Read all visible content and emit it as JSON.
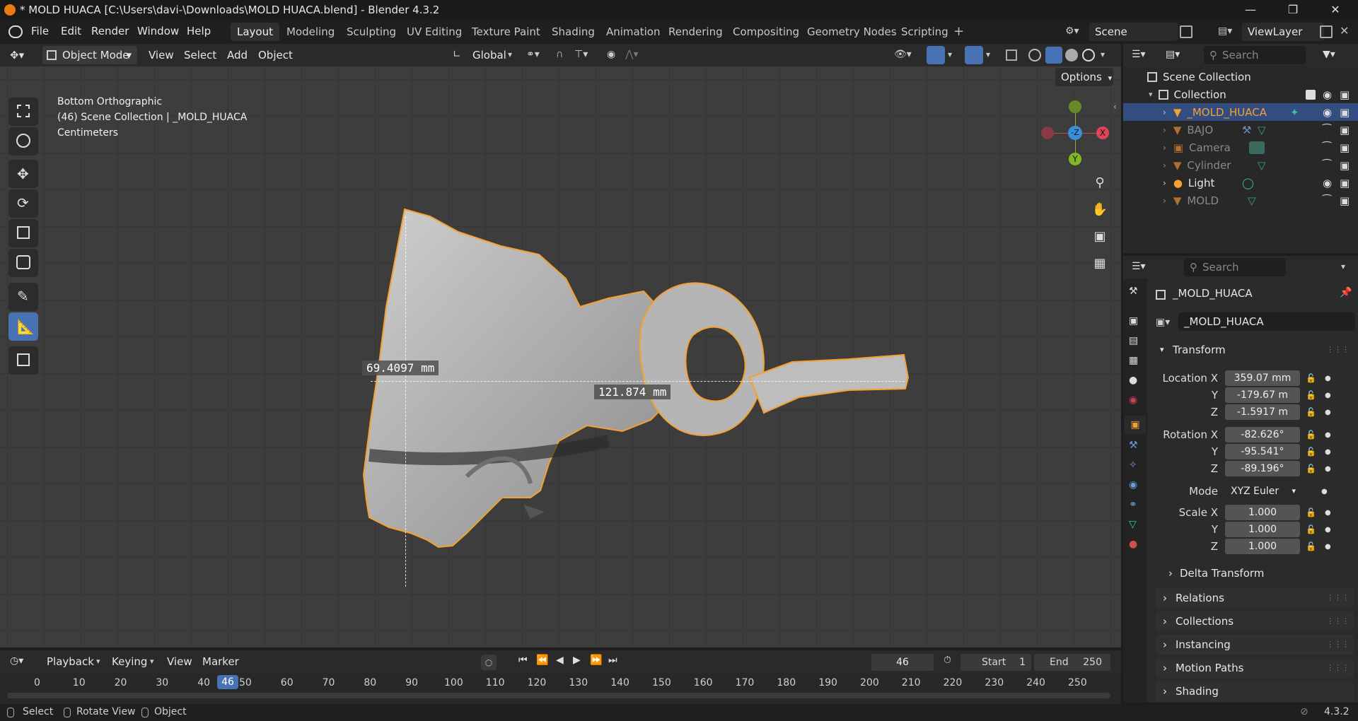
{
  "window": {
    "title": "* MOLD HUACA [C:\\Users\\davi-\\Downloads\\MOLD HUACA.blend] - Blender 4.3.2"
  },
  "menu": [
    "File",
    "Edit",
    "Render",
    "Window",
    "Help"
  ],
  "workspaces": [
    {
      "label": "Layout",
      "active": true
    },
    {
      "label": "Modeling"
    },
    {
      "label": "Sculpting"
    },
    {
      "label": "UV Editing"
    },
    {
      "label": "Texture Paint"
    },
    {
      "label": "Shading"
    },
    {
      "label": "Animation"
    },
    {
      "label": "Rendering"
    },
    {
      "label": "Compositing"
    },
    {
      "label": "Geometry Nodes"
    },
    {
      "label": "Scripting"
    }
  ],
  "scene": {
    "label": "Scene"
  },
  "viewlayer": {
    "label": "ViewLayer"
  },
  "viewport_header": {
    "mode": "Object Mode",
    "menus": [
      "View",
      "Select",
      "Add",
      "Object"
    ],
    "orientation": "Global",
    "options_label": "Options"
  },
  "viewport": {
    "view_name": "Bottom Orthographic",
    "collection_info": "(46) Scene Collection | _MOLD_HUACA",
    "units": "Centimeters",
    "measure_1": "69.4097 mm",
    "measure_2": "121.874 mm",
    "gizmo": {
      "z": "-Z",
      "x": "X",
      "y": "Y"
    }
  },
  "outliner": {
    "search_placeholder": "Search",
    "scene_collection": "Scene Collection",
    "collection": "Collection",
    "items": [
      {
        "name": "_MOLD_HUACA",
        "selected": true
      },
      {
        "name": "BAJO"
      },
      {
        "name": "Camera"
      },
      {
        "name": "Cylinder"
      },
      {
        "name": "Light"
      },
      {
        "name": "MOLD"
      }
    ]
  },
  "properties": {
    "search_placeholder": "Search",
    "object_name_header": "_MOLD_HUACA",
    "object_name_field": "_MOLD_HUACA",
    "transform_label": "Transform",
    "location_label": "Location X",
    "location": {
      "x": "359.07 mm",
      "y": "-179.67 m",
      "z": "-1.5917 m"
    },
    "rotation_label": "Rotation X",
    "rotation": {
      "x": "-82.626°",
      "y": "-95.541°",
      "z": "-89.196°"
    },
    "mode_label": "Mode",
    "mode_value": "XYZ Euler",
    "scale_label": "Scale X",
    "scale": {
      "x": "1.000",
      "y": "1.000",
      "z": "1.000"
    },
    "axis_y": "Y",
    "axis_z": "Z",
    "panels": [
      "Delta Transform",
      "Relations",
      "Collections",
      "Instancing",
      "Motion Paths",
      "Shading"
    ]
  },
  "timeline": {
    "menus": [
      "Playback",
      "Keying",
      "View",
      "Marker"
    ],
    "current_frame": "46",
    "start_label": "Start",
    "start_value": "1",
    "end_label": "End",
    "end_value": "250",
    "ticks": [
      "0",
      "10",
      "20",
      "30",
      "40",
      "50",
      "60",
      "70",
      "80",
      "90",
      "100",
      "110",
      "120",
      "130",
      "140",
      "150",
      "160",
      "170",
      "180",
      "190",
      "200",
      "210",
      "220",
      "230",
      "240",
      "250"
    ]
  },
  "statusbar": {
    "select": "Select",
    "rotate": "Rotate View",
    "object": "Object",
    "version": "4.3.2"
  },
  "colors": {
    "accent": "#4772b3",
    "selection_outline": "#f5a030",
    "selected_row": "#334d80"
  }
}
